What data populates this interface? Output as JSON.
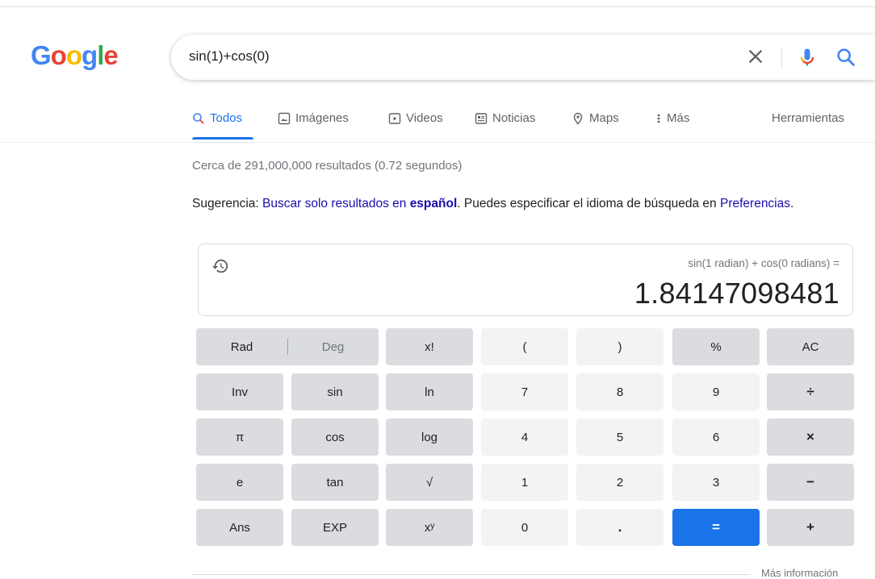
{
  "logo": {
    "letters": [
      "G",
      "o",
      "o",
      "g",
      "l",
      "e"
    ],
    "colors": [
      "#4285F4",
      "#EA4335",
      "#FBBC05",
      "#4285F4",
      "#34A853",
      "#EA4335"
    ]
  },
  "search": {
    "query": "sin(1)+cos(0)",
    "clear_icon": "close-icon",
    "mic_icon": "mic-icon",
    "search_icon": "search-icon"
  },
  "tabs": [
    {
      "label": "Todos",
      "icon": "search-icon"
    },
    {
      "label": "Imágenes",
      "icon": "image-icon"
    },
    {
      "label": "Videos",
      "icon": "video-icon"
    },
    {
      "label": "Noticias",
      "icon": "news-icon"
    },
    {
      "label": "Maps",
      "icon": "map-pin-icon"
    },
    {
      "label": "Más",
      "icon": "more-vert-icon"
    }
  ],
  "tools_label": "Herramientas",
  "stats": "Cerca de 291,000,000 resultados (0.72 segundos)",
  "suggestion": {
    "prefix": "Sugerencia: ",
    "link1": "Buscar solo resultados en ",
    "link1_bold": "español",
    "middle": ". Puedes especificar el idioma de búsqueda en ",
    "link2": "Preferencias",
    "suffix": "."
  },
  "calculator": {
    "expression": "sin(1 radian) + cos(0 radians) =",
    "result": "1.84147098481",
    "rad": "Rad",
    "deg": "Deg",
    "keys": [
      [
        "x!",
        "(",
        ")",
        "%",
        "AC"
      ],
      [
        "Inv",
        "sin",
        "ln",
        "7",
        "8",
        "9",
        "÷"
      ],
      [
        "π",
        "cos",
        "log",
        "4",
        "5",
        "6",
        "×"
      ],
      [
        "e",
        "tan",
        "√",
        "1",
        "2",
        "3",
        "−"
      ],
      [
        "Ans",
        "EXP",
        "xʸ",
        "0",
        ".",
        "=",
        "+"
      ]
    ]
  },
  "more_info": "Más información",
  "colors": {
    "accent": "#1a73e8",
    "link": "#1a0dab"
  }
}
